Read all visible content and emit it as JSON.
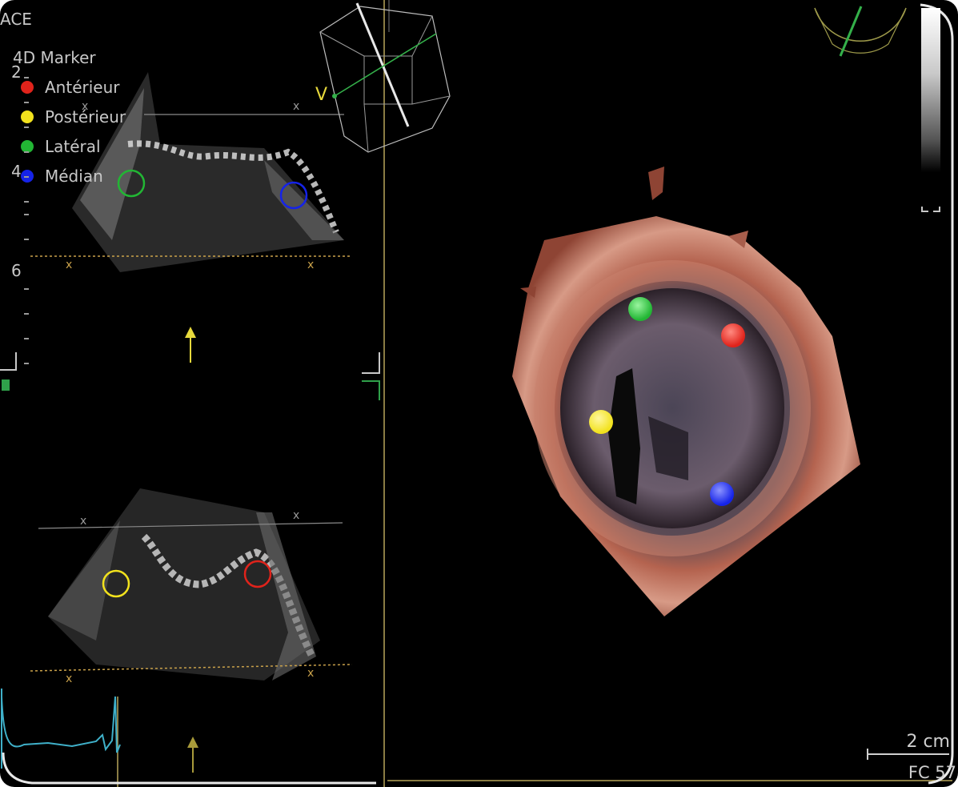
{
  "header": {
    "mode_label": "ACE"
  },
  "legend": {
    "title": "4D Marker",
    "items": [
      {
        "label": "Antérieur",
        "color": "#e0231b"
      },
      {
        "label": "Postérieur",
        "color": "#f2e21d"
      },
      {
        "label": "Latéral",
        "color": "#22b634"
      },
      {
        "label": "Médian",
        "color": "#1523e8"
      }
    ]
  },
  "depth_scale": {
    "labels": [
      "2",
      "4",
      "6"
    ]
  },
  "orientation_label": "V",
  "scale_bar": {
    "label": "2 cm"
  },
  "frame_rate": {
    "label": "FC 57"
  },
  "colors": {
    "guide_line": "#c9a14a",
    "plane_line": "#8a8a8a",
    "arrow": "#e7d93c",
    "ecg": "#3fb0c9",
    "tissue": "#b4634f"
  }
}
